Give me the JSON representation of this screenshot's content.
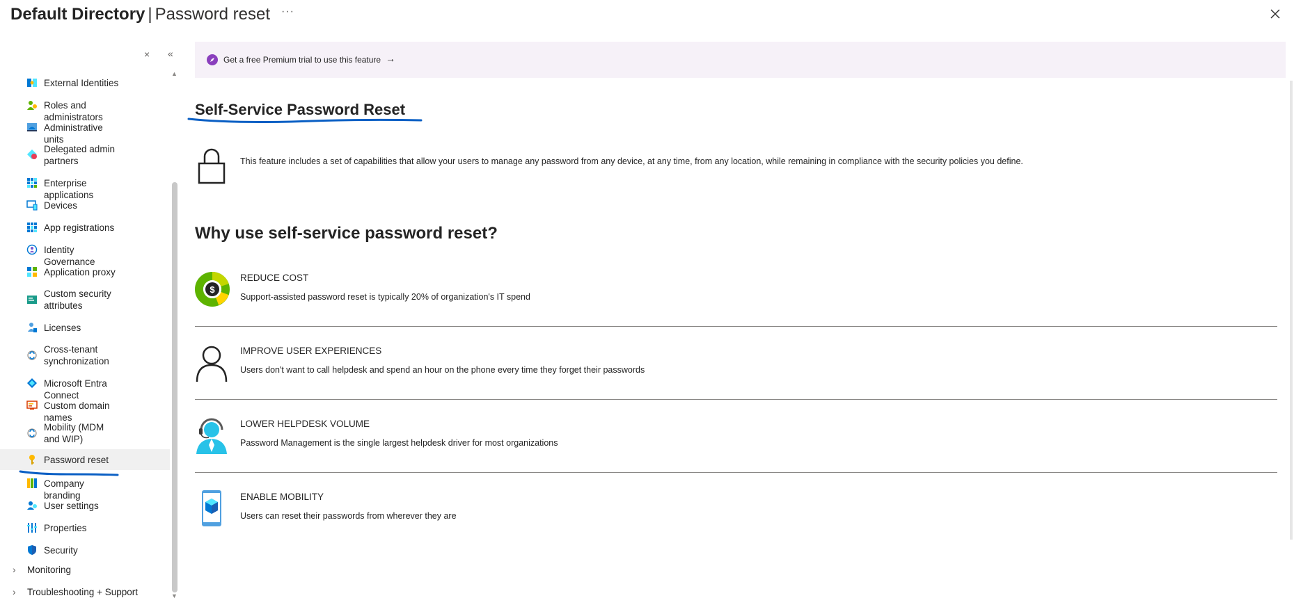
{
  "header": {
    "title_bold": "Default Directory",
    "separator": "|",
    "title_page": "Password reset",
    "more_label": "···"
  },
  "sidebar": {
    "items": [
      {
        "label": "External Identities",
        "icon": "external-identities-icon"
      },
      {
        "label": "Roles and administrators",
        "icon": "roles-icon"
      },
      {
        "label": "Administrative units",
        "icon": "admin-units-icon"
      },
      {
        "label": "Delegated admin partners",
        "icon": "delegated-admin-icon"
      },
      {
        "label": "Enterprise applications",
        "icon": "enterprise-apps-icon"
      },
      {
        "label": "Devices",
        "icon": "devices-icon"
      },
      {
        "label": "App registrations",
        "icon": "app-registrations-icon"
      },
      {
        "label": "Identity Governance",
        "icon": "identity-governance-icon"
      },
      {
        "label": "Application proxy",
        "icon": "application-proxy-icon"
      },
      {
        "label": "Custom security attributes",
        "icon": "custom-security-icon"
      },
      {
        "label": "Licenses",
        "icon": "licenses-icon"
      },
      {
        "label": "Cross-tenant synchronization",
        "icon": "cross-tenant-icon"
      },
      {
        "label": "Microsoft Entra Connect",
        "icon": "entra-connect-icon"
      },
      {
        "label": "Custom domain names",
        "icon": "domain-names-icon"
      },
      {
        "label": "Mobility (MDM and WIP)",
        "icon": "mobility-icon"
      },
      {
        "label": "Password reset",
        "icon": "key-icon",
        "active": true
      },
      {
        "label": "Company branding",
        "icon": "branding-icon"
      },
      {
        "label": "User settings",
        "icon": "user-settings-icon"
      },
      {
        "label": "Properties",
        "icon": "properties-icon"
      },
      {
        "label": "Security",
        "icon": "shield-icon"
      }
    ],
    "groups": [
      {
        "label": "Monitoring"
      },
      {
        "label": "Troubleshooting + Support"
      }
    ]
  },
  "main": {
    "banner_text": "Get a free Premium trial to use this feature",
    "banner_arrow": "→",
    "heading": "Self-Service Password Reset",
    "intro": "This feature includes a set of capabilities that allow your users to manage any password from any device, at any time, from any location, while remaining in compliance with the security policies you define.",
    "why_heading": "Why use self-service password reset?",
    "benefits": [
      {
        "title": "REDUCE COST",
        "desc": "Support-assisted password reset is typically 20% of organization's IT spend",
        "icon": "cost-donut-icon"
      },
      {
        "title": "IMPROVE USER EXPERIENCES",
        "desc": "Users don't want to call helpdesk and spend an hour on the phone every time they forget their passwords",
        "icon": "user-icon"
      },
      {
        "title": "LOWER HELPDESK VOLUME",
        "desc": "Password Management is the single largest helpdesk driver for most organizations",
        "icon": "helpdesk-agent-icon"
      },
      {
        "title": "ENABLE MOBILITY",
        "desc": "Users can reset their passwords from wherever they are",
        "icon": "mobile-device-icon"
      }
    ],
    "cost_symbol": "$"
  },
  "colors": {
    "accent_blue": "#0078d4",
    "annotation_blue": "#0a5fc4",
    "banner_bg": "#f6f1f8",
    "active_bg": "#f0f0f0"
  }
}
